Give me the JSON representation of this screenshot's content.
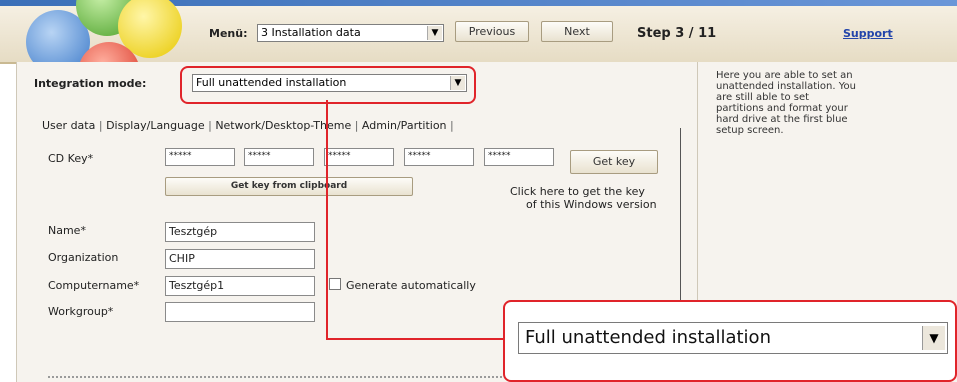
{
  "topbar": {
    "menu_label": "Menü:",
    "menu_value": "3 Installation data",
    "previous_label": "Previous",
    "next_label": "Next",
    "step_label": "Step 3 / 11",
    "support_label": "Support"
  },
  "integration": {
    "label": "Integration mode:",
    "value": "Full unattended installation"
  },
  "tabs": [
    "User data",
    "Display/Language",
    "Network/Desktop-Theme",
    "Admin/Partition"
  ],
  "form": {
    "cdkey_label": "CD Key*",
    "cdkey_values": [
      "*****",
      "*****",
      "*****",
      "*****",
      "*****"
    ],
    "get_key_label": "Get key",
    "clipboard_label": "Get key from clipboard",
    "hint_line1": "Click here to get the key",
    "hint_line2": "of this Windows version",
    "name_label": "Name*",
    "name_value": "Tesztgép",
    "org_label": "Organization",
    "org_value": "CHIP",
    "comp_label": "Computername*",
    "comp_value": "Tesztgép1",
    "generate_label": "Generate automatically",
    "workgroup_label": "Workgroup*",
    "workgroup_value": ""
  },
  "help": {
    "line1": "Here you are able to set an",
    "line2": "unattended installation. You",
    "line3": "are still able to set",
    "line4": "partitions and format your",
    "line5": "hard drive at the first blue",
    "line6": "setup screen."
  },
  "zoom": {
    "value": "Full unattended installation"
  },
  "colors": {
    "highlight": "#e0242a",
    "link": "#2244aa"
  }
}
